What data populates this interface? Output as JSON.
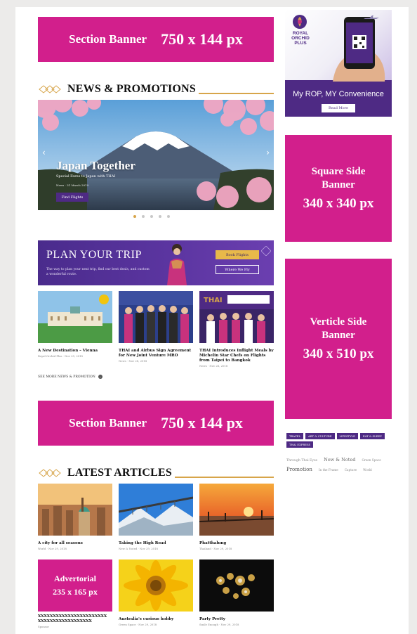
{
  "banners": {
    "top": {
      "label": "Section Banner",
      "size": "750 x 144 px"
    },
    "middle": {
      "label": "Section Banner",
      "size": "750 x 144 px"
    }
  },
  "sections": {
    "news": {
      "title": "NEWS & PROMOTIONS"
    },
    "articles": {
      "title": "LATEST ARTICLES"
    }
  },
  "hero": {
    "title": "Japan Together",
    "subtitle": "Special Fares to Japan with THAI",
    "meta": "News · 31 March 2019",
    "button": "Find Flights",
    "prev_icon": "chevron-left-icon",
    "next_icon": "chevron-right-icon",
    "slides": 5,
    "active_slide": 1
  },
  "plan_trip": {
    "title": "PLAN YOUR TRIP",
    "description": "The way to plan your next trip, find our best deals, and custom a wonderful route.",
    "book_button": "Book Flights",
    "where_button": "Where We Fly"
  },
  "news_cards": [
    {
      "title": "A New Destination – Vienna",
      "meta": "Royal Orchid Plus · Nov 29, 2018"
    },
    {
      "title": "THAI and Airbus Sign Agreement for New Joint Venture MRO",
      "meta": "News · Nov 28, 2018"
    },
    {
      "title": "THAI Introduces Inflight Meals by Michelin Star Chefs on Flights from Taipei to Bangkok",
      "meta": "News · Nov 26, 2018"
    }
  ],
  "see_more": "SEE MORE NEWS & PROMOTION",
  "article_cards": [
    {
      "title": "A city for all seasons",
      "meta": "World · Nov 29, 2018"
    },
    {
      "title": "Taking the High Road",
      "meta": "New & Noted · Nov 29, 2018"
    },
    {
      "title": "Phatthalung",
      "meta": "Thailand · Nov 29, 2018"
    }
  ],
  "advertorial": {
    "label": "Advertorial",
    "size": "235 x 165 px",
    "title": "XXXXXXXXXXXXXXXXXXXXXXXXXXXXXXXXXXXXXXXXX",
    "meta": "Sponsor"
  },
  "article_cards_2": [
    {
      "title": "Australia's curious hobby",
      "meta": "Green Space · Nov 29, 2018"
    },
    {
      "title": "Party Pretty",
      "meta": "Smile Enough · Nov 29, 2018"
    }
  ],
  "side_promo": {
    "brand_line1": "ROYAL",
    "brand_line2": "ORCHID",
    "brand_line3": "PLUS",
    "caption": "My ROP, MY Convenience",
    "button": "Read More"
  },
  "side_square": {
    "line1": "Square Side",
    "line2": "Banner",
    "size": "340 x 340 px"
  },
  "side_vertical": {
    "line1": "Verticle Side",
    "line2": "Banner",
    "size": "340 x 510 px"
  },
  "tags": [
    "TRAVEL",
    "ART & CULTURE",
    "LIFESTYLE",
    "EAT & SLEEP",
    "THAI EXPRESS"
  ],
  "tag_cloud": [
    "Through Thai Eyes",
    "New & Noted",
    "Green Space",
    "Promotion",
    "In the Frame",
    "Capture",
    "World"
  ],
  "colors": {
    "magenta": "#d21f8c",
    "purple": "#4e2a84",
    "gold": "#d7a54a"
  }
}
